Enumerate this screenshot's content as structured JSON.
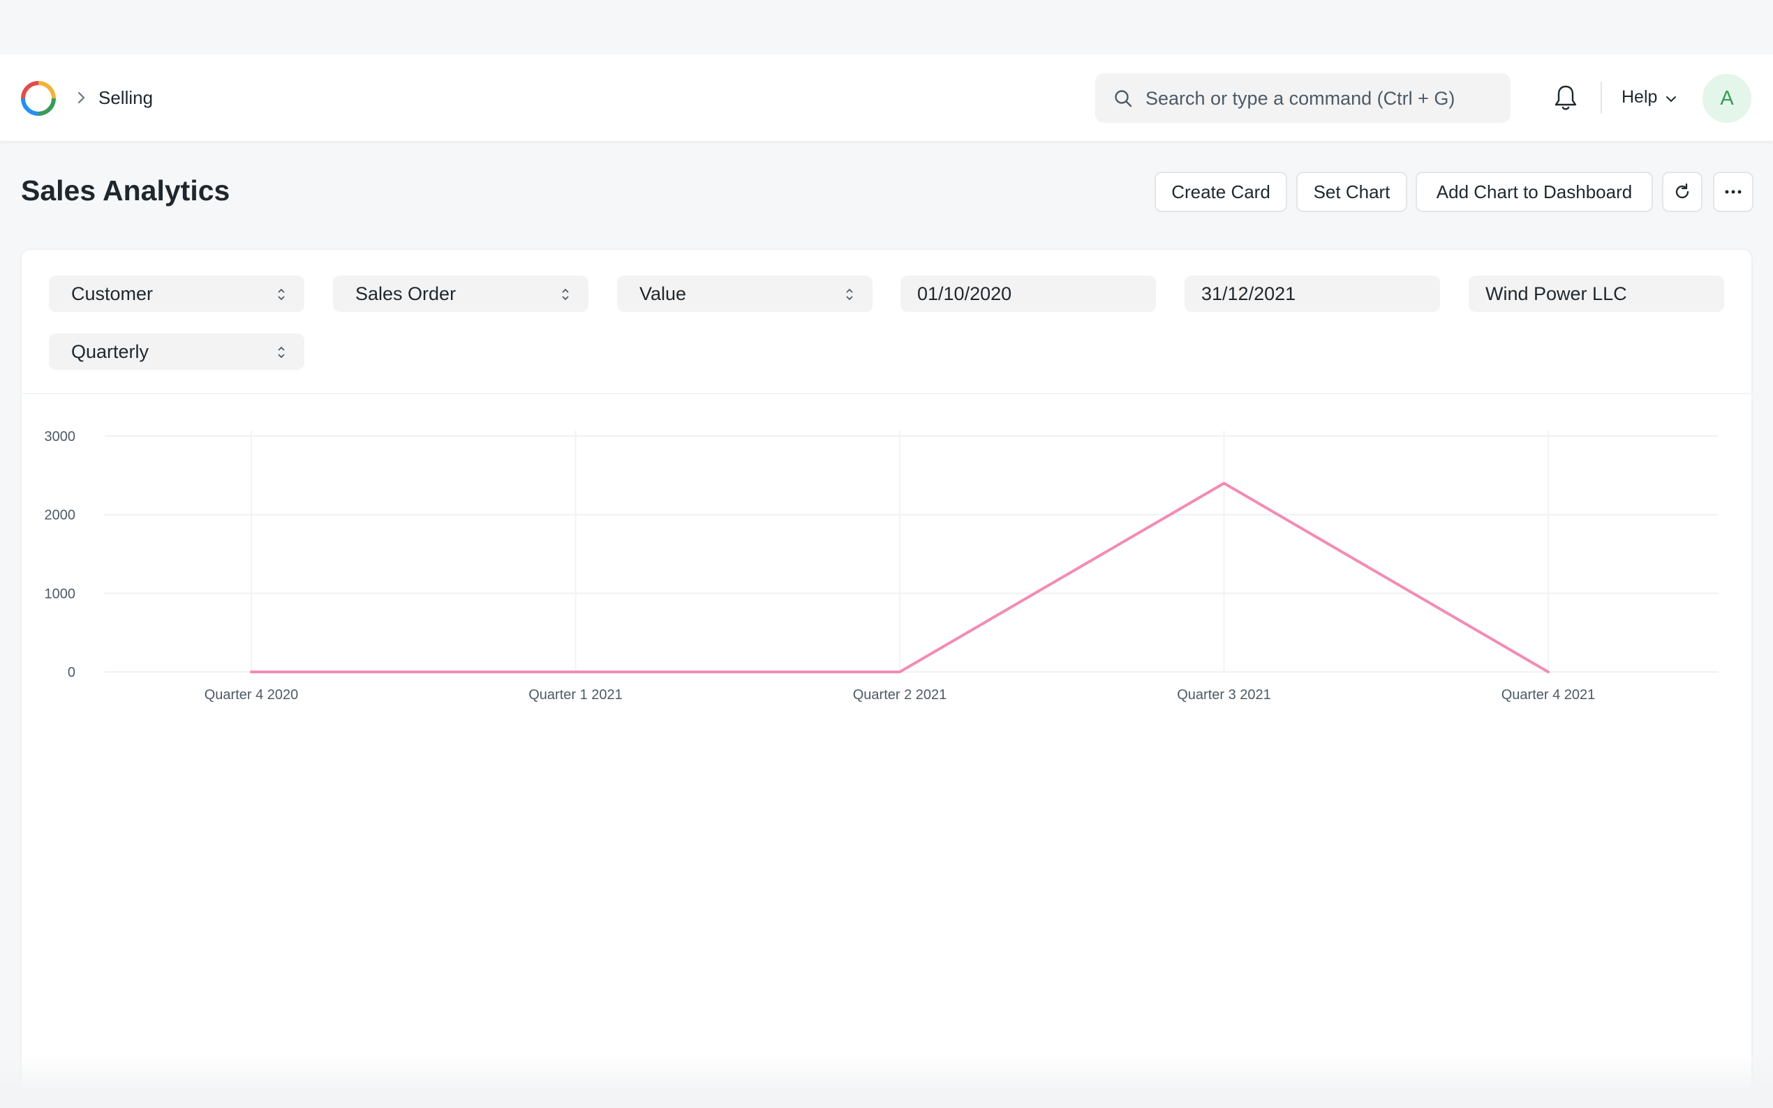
{
  "navbar": {
    "breadcrumb": "Selling",
    "search_placeholder": "Search or type a command (Ctrl + G)",
    "help_label": "Help",
    "avatar_initial": "A"
  },
  "page": {
    "title": "Sales Analytics",
    "actions": {
      "create_card": "Create Card",
      "set_chart": "Set Chart",
      "add_to_dashboard": "Add Chart to Dashboard"
    }
  },
  "filters": {
    "tree_type": "Customer",
    "doc_type": "Sales Order",
    "value_quantity": "Value",
    "from_date": "01/10/2020",
    "to_date": "31/12/2021",
    "company": "Wind Power LLC",
    "range": "Quarterly"
  },
  "colors": {
    "line": "#f38bb5",
    "avatar_bg": "#e4f5e9",
    "avatar_text": "#3a9b57"
  },
  "icons": [
    "app-logo-icon",
    "chevron-right-icon",
    "search-icon",
    "bell-icon",
    "chevron-down-icon",
    "refresh-icon",
    "more-icon",
    "select-arrows-icon"
  ],
  "chart_data": {
    "type": "line",
    "categories": [
      "Quarter 4 2020",
      "Quarter 1 2021",
      "Quarter 2 2021",
      "Quarter 3 2021",
      "Quarter 4 2021"
    ],
    "series": [
      {
        "values": [
          0,
          0,
          0,
          2400,
          0
        ]
      }
    ],
    "yticks": [
      "0",
      "1000",
      "2000",
      "3000"
    ],
    "ylim": [
      0,
      3000
    ],
    "grid": true,
    "legend": "none"
  }
}
